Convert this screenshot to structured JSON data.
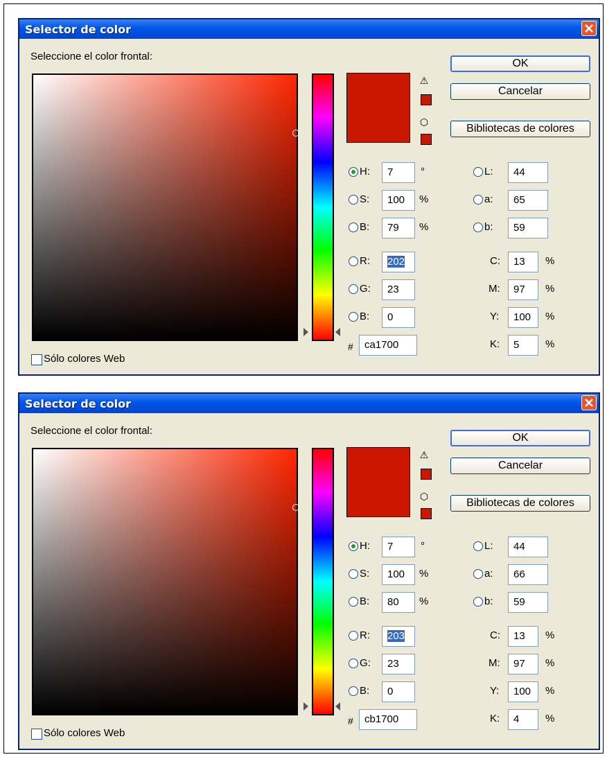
{
  "dialogs": [
    {
      "title": "Selector de color",
      "prompt": "Seleccione el color frontal:",
      "swatch_color": "#ca1700",
      "buttons": {
        "ok": "OK",
        "cancel": "Cancelar",
        "libraries": "Bibliotecas de colores"
      },
      "hsb": {
        "h": {
          "label": "H:",
          "value": "7",
          "unit": "°"
        },
        "s": {
          "label": "S:",
          "value": "100",
          "unit": "%"
        },
        "b": {
          "label": "B:",
          "value": "79",
          "unit": "%"
        }
      },
      "rgb": {
        "r": {
          "label": "R:",
          "value": "202"
        },
        "g": {
          "label": "G:",
          "value": "23"
        },
        "b": {
          "label": "B:",
          "value": "0"
        }
      },
      "lab": {
        "l": {
          "label": "L:",
          "value": "44"
        },
        "a": {
          "label": "a:",
          "value": "65"
        },
        "b": {
          "label": "b:",
          "value": "59"
        }
      },
      "cmyk": {
        "c": {
          "label": "C:",
          "value": "13",
          "unit": "%"
        },
        "m": {
          "label": "M:",
          "value": "97",
          "unit": "%"
        },
        "y": {
          "label": "Y:",
          "value": "100",
          "unit": "%"
        },
        "k": {
          "label": "K:",
          "value": "5",
          "unit": "%"
        }
      },
      "hex_symbol": "#",
      "hex": "ca1700",
      "web_only": "Sólo colores Web"
    },
    {
      "title": "Selector de color",
      "prompt": "Seleccione el color frontal:",
      "swatch_color": "#cb1700",
      "buttons": {
        "ok": "OK",
        "cancel": "Cancelar",
        "libraries": "Bibliotecas de colores"
      },
      "hsb": {
        "h": {
          "label": "H:",
          "value": "7",
          "unit": "°"
        },
        "s": {
          "label": "S:",
          "value": "100",
          "unit": "%"
        },
        "b": {
          "label": "B:",
          "value": "80",
          "unit": "%"
        }
      },
      "rgb": {
        "r": {
          "label": "R:",
          "value": "203"
        },
        "g": {
          "label": "G:",
          "value": "23"
        },
        "b": {
          "label": "B:",
          "value": "0"
        }
      },
      "lab": {
        "l": {
          "label": "L:",
          "value": "44"
        },
        "a": {
          "label": "a:",
          "value": "66"
        },
        "b": {
          "label": "b:",
          "value": "59"
        }
      },
      "cmyk": {
        "c": {
          "label": "C:",
          "value": "13",
          "unit": "%"
        },
        "m": {
          "label": "M:",
          "value": "97",
          "unit": "%"
        },
        "y": {
          "label": "Y:",
          "value": "100",
          "unit": "%"
        },
        "k": {
          "label": "K:",
          "value": "4",
          "unit": "%"
        }
      },
      "hex_symbol": "#",
      "hex": "cb1700",
      "web_only": "Sólo colores Web"
    }
  ]
}
